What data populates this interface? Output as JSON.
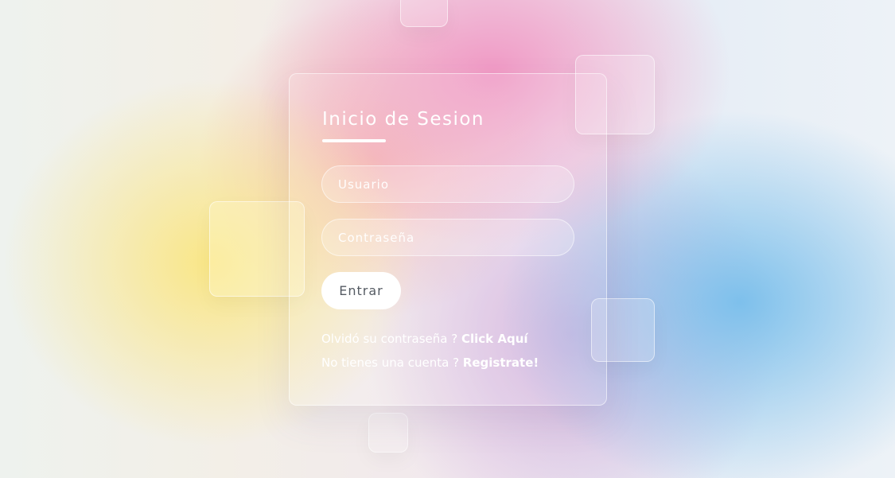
{
  "login": {
    "title": "Inicio de Sesion",
    "username_placeholder": "Usuario",
    "password_placeholder": "Contraseña",
    "submit_label": "Entrar",
    "forgot_text": "Olvidó su contraseña ? ",
    "forgot_link": "Click Aquí",
    "register_text": "No tienes una cuenta ? ",
    "register_link": "Registrate!"
  }
}
